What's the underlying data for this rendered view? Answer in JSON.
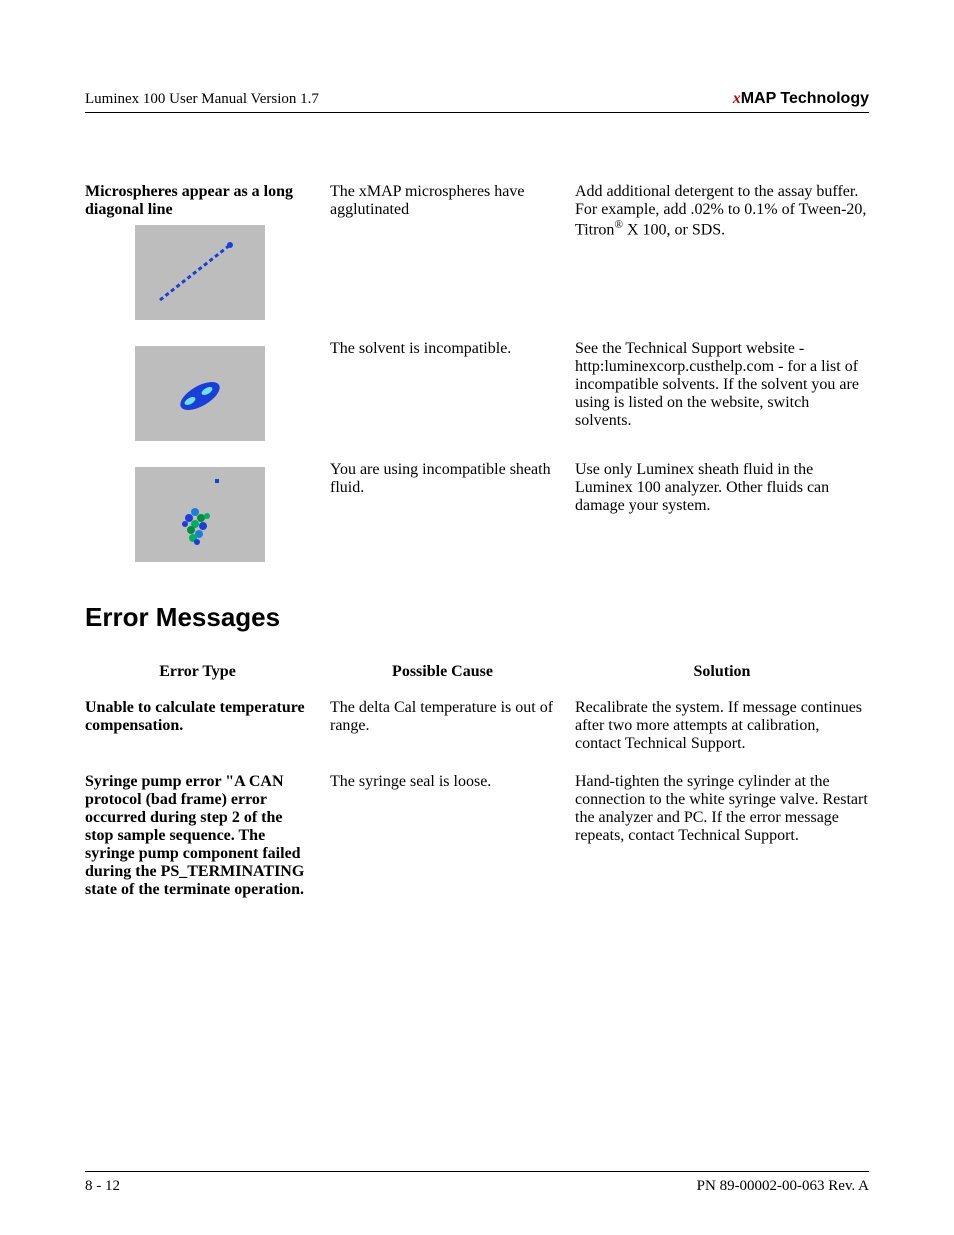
{
  "header": {
    "left": "Luminex 100 User Manual Version 1.7",
    "right_prefix": "x",
    "right_rest": "MAP Technology"
  },
  "troubleshoot": {
    "rows": [
      {
        "label": "Microspheres appear as a long diagonal line",
        "cause": "The xMAP microspheres have agglutinated",
        "solution_html": "Add additional detergent to the assay buffer. For example, add .02% to 0.1% of Tween-20, Titron<sup>®</sup> X 100, or SDS."
      },
      {
        "label": "",
        "cause": "The solvent is incompatible.",
        "solution": "See the Technical Support website - http:luminexcorp.custhelp.com - for a list of incompatible solvents. If the solvent you are using is listed on the website, switch solvents."
      },
      {
        "label": "",
        "cause": "You are using incompatible sheath fluid.",
        "solution": "Use only Luminex sheath fluid in the Luminex 100 analyzer. Other fluids can damage your system."
      }
    ]
  },
  "section_title": "Error Messages",
  "error_table": {
    "headers": [
      "Error Type",
      "Possible Cause",
      "Solution"
    ],
    "rows": [
      {
        "type": "Unable to calculate temperature compensation.",
        "cause": "The delta Cal temperature is out of range.",
        "solution": "Recalibrate the system. If message continues after two more attempts at calibration, contact Technical Support."
      },
      {
        "type": "Syringe pump error \"A CAN protocol (bad frame) error occurred during step 2 of the stop sample sequence. The syringe pump component failed during the PS_TERMINATING state of the terminate operation.",
        "cause": "The syringe seal is loose.",
        "solution": "Hand-tighten the syringe cylinder at the connection to the white syringe valve. Restart the analyzer and PC. If the error message repeats, contact Technical Support."
      }
    ]
  },
  "footer": {
    "left": "8 - 12",
    "right": "PN 89-00002-00-063 Rev. A"
  }
}
